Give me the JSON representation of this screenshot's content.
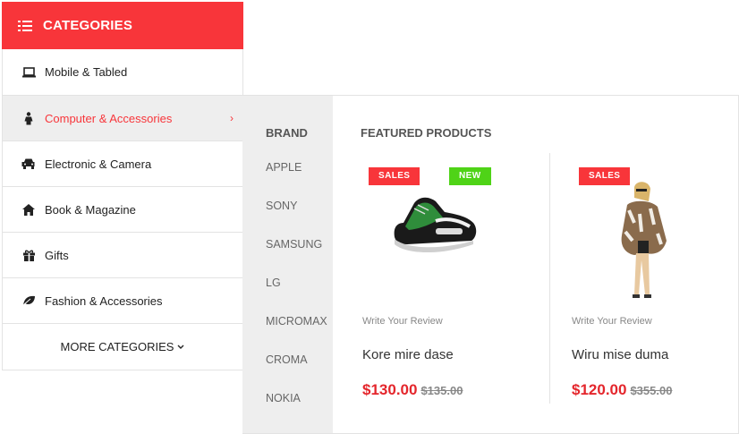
{
  "menu": {
    "header": "CATEGORIES",
    "items": [
      {
        "label": "Mobile & Tabled",
        "icon": "laptop-icon"
      },
      {
        "label": "Computer & Accessories",
        "icon": "person-icon",
        "active": true
      },
      {
        "label": "Electronic & Camera",
        "icon": "car-icon"
      },
      {
        "label": "Book & Magazine",
        "icon": "home-icon"
      },
      {
        "label": "Gifts",
        "icon": "gift-icon"
      },
      {
        "label": "Fashion & Accessories",
        "icon": "leaf-icon"
      }
    ],
    "more": "MORE CATEGORIES"
  },
  "mega": {
    "brand_title": "BRAND",
    "brands": [
      "APPLE",
      "SONY",
      "SAMSUNG",
      "LG",
      "MICROMAX",
      "CROMA",
      "NOKIA"
    ],
    "featured_title": "FEATURED PRODUCTS",
    "products": [
      {
        "badges": [
          "SALES",
          "NEW"
        ],
        "review": "Write Your Review",
        "name": "Kore mire dase",
        "price": "$130.00",
        "old_price": "$135.00",
        "image": "sneaker"
      },
      {
        "badges": [
          "SALES"
        ],
        "review": "Write Your Review",
        "name": "Wiru mise duma",
        "price": "$120.00",
        "old_price": "$355.00",
        "image": "fur-coat-model"
      }
    ]
  },
  "colors": {
    "accent": "#f8353a",
    "new_badge": "#4fd317",
    "price": "#e4262c"
  }
}
